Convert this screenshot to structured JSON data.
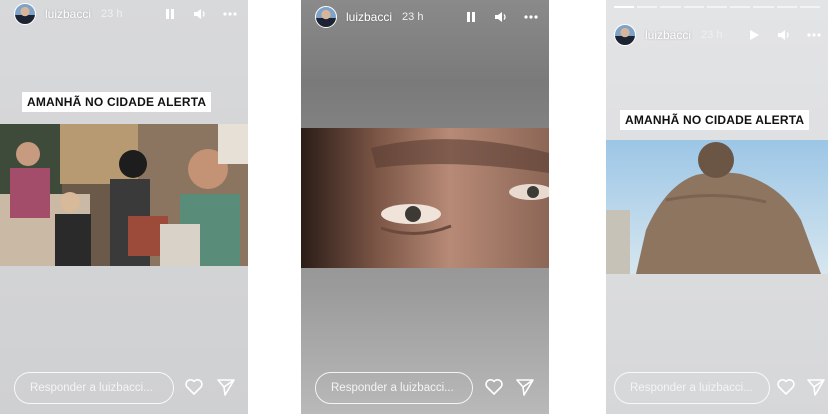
{
  "stories": [
    {
      "username": "luizbacci",
      "time": "23 h",
      "banner": "AMANHÃ NO CIDADE ALERTA",
      "reply_placeholder": "Responder a luizbacci...",
      "controls": [
        "pause-icon",
        "volume-icon",
        "more-icon"
      ]
    },
    {
      "username": "luizbacci",
      "time": "23 h",
      "banner": "",
      "reply_placeholder": "Responder a luizbacci...",
      "controls": [
        "pause-icon",
        "volume-icon",
        "more-icon"
      ]
    },
    {
      "username": "luizbacci",
      "time": "23 h",
      "banner": "AMANHÃ NO CIDADE ALERTA",
      "reply_placeholder": "Responder a luizbacci...",
      "controls": [
        "play-icon",
        "volume-icon",
        "more-icon"
      ],
      "progress_segments_total": 9,
      "progress_segments_done": 1
    }
  ],
  "colors": {
    "overlay_text": "#ffffff",
    "banner_bg": "#ffffff",
    "banner_text": "#111111"
  }
}
